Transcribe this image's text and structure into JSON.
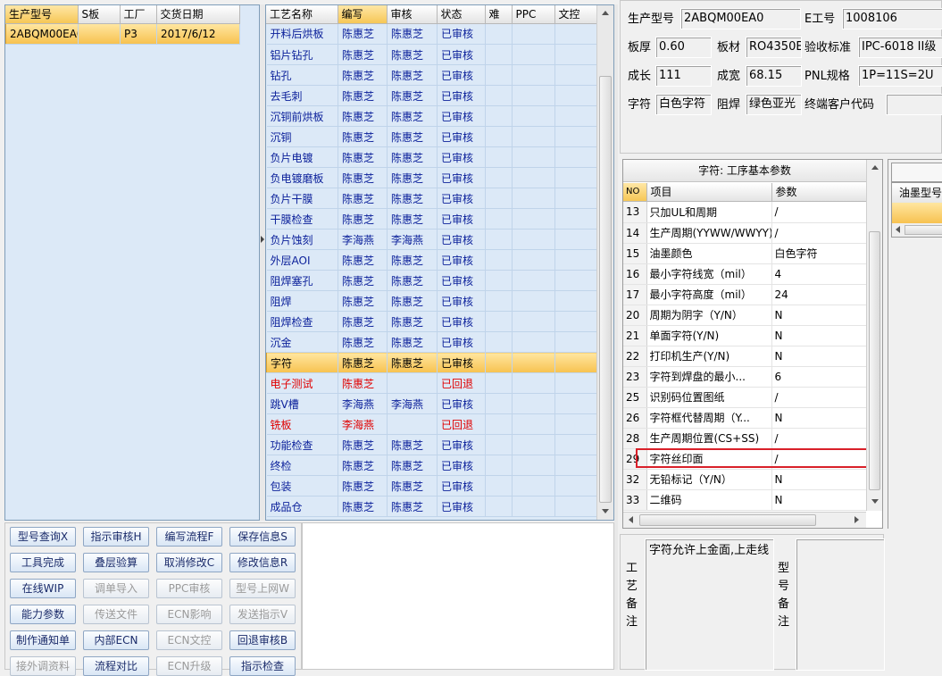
{
  "models": {
    "columns": [
      "生产型号",
      "S板",
      "工厂",
      "交货日期"
    ],
    "rows": [
      {
        "model": "2ABQM00EA0",
        "s_board": "",
        "factory": "P3",
        "date": "2017/6/12"
      }
    ]
  },
  "process": {
    "columns": [
      "工艺名称",
      "编写",
      "审核",
      "状态",
      "难",
      "PPC",
      "文控"
    ],
    "rows": [
      {
        "name": "开料后烘板",
        "writer": "陈惠芝",
        "reviewer": "陈惠芝",
        "status": "已审核"
      },
      {
        "name": "铝片钻孔",
        "writer": "陈惠芝",
        "reviewer": "陈惠芝",
        "status": "已审核"
      },
      {
        "name": "钻孔",
        "writer": "陈惠芝",
        "reviewer": "陈惠芝",
        "status": "已审核"
      },
      {
        "name": "去毛刺",
        "writer": "陈惠芝",
        "reviewer": "陈惠芝",
        "status": "已审核"
      },
      {
        "name": "沉铜前烘板",
        "writer": "陈惠芝",
        "reviewer": "陈惠芝",
        "status": "已审核"
      },
      {
        "name": "沉铜",
        "writer": "陈惠芝",
        "reviewer": "陈惠芝",
        "status": "已审核"
      },
      {
        "name": "负片电镀",
        "writer": "陈惠芝",
        "reviewer": "陈惠芝",
        "status": "已审核"
      },
      {
        "name": "负电镀磨板",
        "writer": "陈惠芝",
        "reviewer": "陈惠芝",
        "status": "已审核"
      },
      {
        "name": "负片干膜",
        "writer": "陈惠芝",
        "reviewer": "陈惠芝",
        "status": "已审核"
      },
      {
        "name": "干膜检查",
        "writer": "陈惠芝",
        "reviewer": "陈惠芝",
        "status": "已审核"
      },
      {
        "name": "负片蚀刻",
        "writer": "李海燕",
        "reviewer": "李海燕",
        "status": "已审核"
      },
      {
        "name": "外层AOI",
        "writer": "陈惠芝",
        "reviewer": "陈惠芝",
        "status": "已审核"
      },
      {
        "name": "阻焊塞孔",
        "writer": "陈惠芝",
        "reviewer": "陈惠芝",
        "status": "已审核"
      },
      {
        "name": "阻焊",
        "writer": "陈惠芝",
        "reviewer": "陈惠芝",
        "status": "已审核"
      },
      {
        "name": "阻焊检查",
        "writer": "陈惠芝",
        "reviewer": "陈惠芝",
        "status": "已审核"
      },
      {
        "name": "沉金",
        "writer": "陈惠芝",
        "reviewer": "陈惠芝",
        "status": "已审核"
      },
      {
        "name": "字符",
        "writer": "陈惠芝",
        "reviewer": "陈惠芝",
        "status": "已审核",
        "selected": true
      },
      {
        "name": "电子测试",
        "writer": "陈惠芝",
        "reviewer": "",
        "status": "已回退",
        "returned": true
      },
      {
        "name": "跳V槽",
        "writer": "李海燕",
        "reviewer": "李海燕",
        "status": "已审核"
      },
      {
        "name": "铣板",
        "writer": "李海燕",
        "reviewer": "",
        "status": "已回退",
        "returned": true
      },
      {
        "name": "功能检查",
        "writer": "陈惠芝",
        "reviewer": "陈惠芝",
        "status": "已审核"
      },
      {
        "name": "终检",
        "writer": "陈惠芝",
        "reviewer": "陈惠芝",
        "status": "已审核"
      },
      {
        "name": "包装",
        "writer": "陈惠芝",
        "reviewer": "陈惠芝",
        "status": "已审核"
      },
      {
        "name": "成品仓",
        "writer": "陈惠芝",
        "reviewer": "陈惠芝",
        "status": "已审核"
      }
    ]
  },
  "info": {
    "model_label": "生产型号",
    "model_value": "2ABQM00EA0",
    "eno_label": "E工号",
    "eno_value": "1008106",
    "thickness_label": "板厚",
    "thickness_value": "0.60",
    "material_label": "板材",
    "material_value": "RO4350E",
    "standard_label": "验收标准",
    "standard_value": "IPC-6018 II级",
    "length_label": "成长",
    "length_value": "111",
    "width_label": "成宽",
    "width_value": "68.15",
    "pnl_label": "PNL规格",
    "pnl_value": "1P=11S=2U",
    "char_label": "字符",
    "char_value": "白色字符",
    "mask_label": "阻焊",
    "mask_value": "绿色亚光",
    "customer_label": "终端客户代码",
    "customer_value": ""
  },
  "params": {
    "title": "字符: 工序基本参数",
    "col_no": "NO",
    "col_item": "项目",
    "col_param": "参数",
    "rows": [
      {
        "no": "13",
        "item": "只加UL和周期",
        "param": "/"
      },
      {
        "no": "14",
        "item": "生产周期(YYWW/WWYY)",
        "param": "/"
      },
      {
        "no": "15",
        "item": "油墨颜色",
        "param": "白色字符"
      },
      {
        "no": "16",
        "item": "最小字符线宽（mil）",
        "param": "4"
      },
      {
        "no": "17",
        "item": "最小字符高度（mil）",
        "param": "24"
      },
      {
        "no": "20",
        "item": "周期为阴字（Y/N）",
        "param": "N"
      },
      {
        "no": "21",
        "item": "单面字符(Y/N)",
        "param": "N"
      },
      {
        "no": "22",
        "item": "打印机生产(Y/N)",
        "param": "N"
      },
      {
        "no": "23",
        "item": "字符到焊盘的最小...",
        "param": "6"
      },
      {
        "no": "25",
        "item": "识别码位置图纸",
        "param": "/"
      },
      {
        "no": "26",
        "item": "字符框代替周期（Y...",
        "param": "N"
      },
      {
        "no": "28",
        "item": "生产周期位置(CS+SS)",
        "param": "/"
      },
      {
        "no": "29",
        "item": "字符丝印面",
        "param": "/"
      },
      {
        "no": "32",
        "item": "无铅标记（Y/N）",
        "param": "N"
      },
      {
        "no": "33",
        "item": "二维码",
        "param": "N"
      }
    ]
  },
  "ink": {
    "column": "油墨型号"
  },
  "notes": {
    "process_label": "工艺备注",
    "process_text": "字符允许上金面,上走线",
    "model_label": "型号备注"
  },
  "buttons": [
    {
      "label": "型号查询X",
      "enabled": true
    },
    {
      "label": "指示审核H",
      "enabled": true
    },
    {
      "label": "编写流程F",
      "enabled": true
    },
    {
      "label": "保存信息S",
      "enabled": true
    },
    {
      "label": "工具完成",
      "enabled": true
    },
    {
      "label": "叠层验算",
      "enabled": true
    },
    {
      "label": "取消修改C",
      "enabled": true
    },
    {
      "label": "修改信息R",
      "enabled": true
    },
    {
      "label": "在线WIP",
      "enabled": true
    },
    {
      "label": "调单导入",
      "enabled": false
    },
    {
      "label": "PPC审核",
      "enabled": false
    },
    {
      "label": "型号上网W",
      "enabled": false
    },
    {
      "label": "能力参数",
      "enabled": true
    },
    {
      "label": "传送文件",
      "enabled": false
    },
    {
      "label": "ECN影响",
      "enabled": false
    },
    {
      "label": "发送指示V",
      "enabled": false
    },
    {
      "label": "制作通知单",
      "enabled": true
    },
    {
      "label": "内部ECN",
      "enabled": true
    },
    {
      "label": "ECN文控",
      "enabled": false
    },
    {
      "label": "回退审核B",
      "enabled": true
    },
    {
      "label": "接外调资料",
      "enabled": false
    },
    {
      "label": "流程对比",
      "enabled": true
    },
    {
      "label": "ECN升级",
      "enabled": false
    },
    {
      "label": "指示检查",
      "enabled": true
    }
  ],
  "colors": {
    "selection": "#f7c250",
    "returned_text": "#e00000",
    "highlight_box": "#d9202a",
    "grid_bg": "#dce9f7"
  }
}
